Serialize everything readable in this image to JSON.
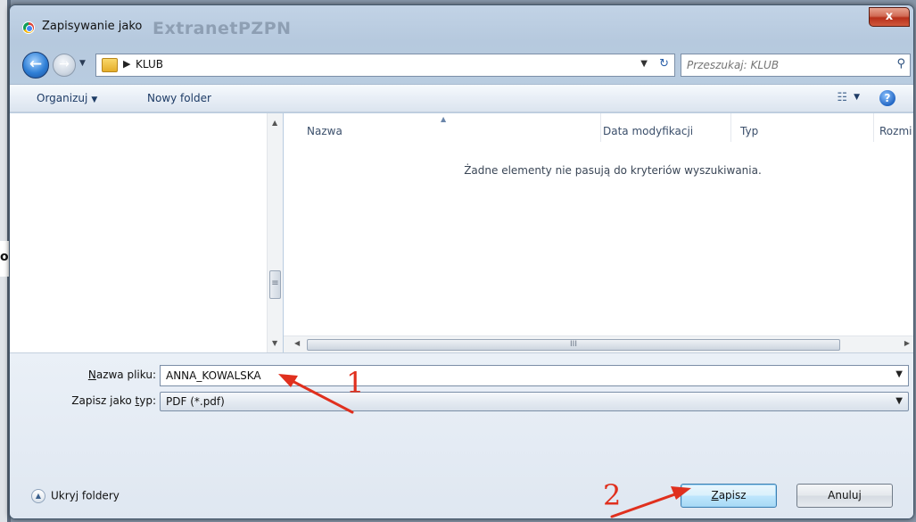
{
  "window": {
    "title": "Zapisywanie jako",
    "title_ghost": "ExtranetPZPN",
    "close_label": "x",
    "background_stub": "o"
  },
  "nav": {
    "address_path": "KLUB",
    "search_placeholder": "Przeszukaj: KLUB"
  },
  "toolbar": {
    "organize_label": "Organizuj",
    "new_folder_label": "Nowy folder",
    "help_label": "?"
  },
  "file_list": {
    "columns": [
      "Nazwa",
      "Data modyfikacji",
      "Typ",
      "Rozmi"
    ],
    "empty_message": "Żadne elementy nie pasują do kryteriów wyszukiwania.",
    "scroll_grip": "III",
    "nav_scroll_grip": "≡"
  },
  "form": {
    "filename_label_underlined": "N",
    "filename_label_rest": "azwa pliku:",
    "filename_value": "ANNA_KOWALSKA",
    "filetype_label_prefix": "Zapisz jako ",
    "filetype_label_underlined": "t",
    "filetype_label_rest": "yp:",
    "filetype_value": "PDF (*.pdf)",
    "hide_folders_label": "Ukryj foldery"
  },
  "buttons": {
    "save_underlined": "Z",
    "save_rest": "apisz",
    "cancel_label": "Anuluj"
  },
  "annotations": {
    "step1": "1",
    "step2": "2",
    "color": "#e0301e"
  },
  "colors": {
    "accent_blue": "#2f7fd6",
    "close_red": "#c73a22"
  }
}
